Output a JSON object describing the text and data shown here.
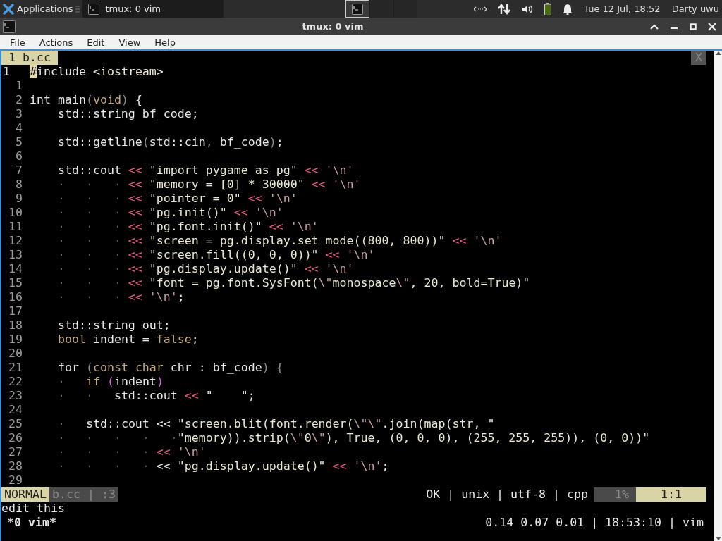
{
  "taskbar": {
    "menu_label": "Applications",
    "tasks": [
      {
        "title": "tmux: 0 vim",
        "selected": true
      }
    ],
    "workspaces": [
      {
        "selected": true
      },
      {
        "selected": false
      },
      {
        "selected": false
      }
    ],
    "clock": "Tue 12 Jul, 18:52",
    "user": "Darty uwu"
  },
  "window": {
    "title": "tmux: 0 vim"
  },
  "menu": [
    "File",
    "Actions",
    "Edit",
    "View",
    "Help"
  ],
  "vim": {
    "tabs": [
      {
        "label": "1 b.cc",
        "selected": true
      }
    ],
    "close_label": "X",
    "lines": [
      {
        "number": "1",
        "current": true,
        "tokens": [
          {
            "kind": "cursor",
            "text": "#"
          },
          {
            "kind": "plain",
            "text": "include "
          },
          {
            "kind": "str",
            "text": "<iostream>"
          }
        ]
      },
      {
        "number": "1",
        "current": false
      },
      {
        "number": "2",
        "current": false,
        "tokens": [
          {
            "kind": "plain",
            "text": "int main"
          },
          {
            "kind": "punct",
            "text": "("
          },
          {
            "kind": "type",
            "text": "void"
          },
          {
            "kind": "punct",
            "text": ")"
          },
          {
            "kind": "plain",
            "text": " {"
          }
        ]
      },
      {
        "number": "3",
        "current": false,
        "tokens": [
          {
            "kind": "plain",
            "text": "    std::string bf_code;"
          }
        ]
      },
      {
        "number": "4",
        "current": false
      },
      {
        "number": "5",
        "current": false,
        "tokens": [
          {
            "kind": "plain",
            "text": "    std::getline"
          },
          {
            "kind": "punct",
            "text": "("
          },
          {
            "kind": "plain",
            "text": "std::cin"
          },
          {
            "kind": "punct",
            "text": ", "
          },
          {
            "kind": "plain",
            "text": "bf_code"
          },
          {
            "kind": "punct",
            "text": ")"
          },
          {
            "kind": "plain",
            "text": ";"
          }
        ]
      },
      {
        "number": "6",
        "current": false
      },
      {
        "number": "7",
        "current": false,
        "tokens": [
          {
            "kind": "plain",
            "text": "    std::cout"
          },
          {
            "kind": "op",
            "text": " << "
          },
          {
            "kind": "str",
            "text": "\"import pygame as pg\""
          },
          {
            "kind": "op",
            "text": " << "
          },
          {
            "kind": "esc",
            "text": "'\\n'"
          }
        ]
      },
      {
        "number": "8",
        "current": false,
        "tokens": [
          {
            "kind": "list",
            "text": "    ·   ·   ·"
          },
          {
            "kind": "op",
            "text": " << "
          },
          {
            "kind": "str",
            "text": "\"memory = [0] * 30000\""
          },
          {
            "kind": "op",
            "text": " << "
          },
          {
            "kind": "esc",
            "text": "'\\n'"
          }
        ]
      },
      {
        "number": "9",
        "current": false,
        "tokens": [
          {
            "kind": "list",
            "text": "    ·   ·   ·"
          },
          {
            "kind": "op",
            "text": " << "
          },
          {
            "kind": "str",
            "text": "\"pointer = 0\""
          },
          {
            "kind": "op",
            "text": " << "
          },
          {
            "kind": "esc",
            "text": "'\\n'"
          }
        ]
      },
      {
        "number": "10",
        "current": false,
        "tokens": [
          {
            "kind": "list",
            "text": "    ·   ·   ·"
          },
          {
            "kind": "op",
            "text": " << "
          },
          {
            "kind": "str",
            "text": "\"pg.init()\""
          },
          {
            "kind": "op",
            "text": " << "
          },
          {
            "kind": "esc",
            "text": "'\\n'"
          }
        ]
      },
      {
        "number": "11",
        "current": false,
        "tokens": [
          {
            "kind": "list",
            "text": "    ·   ·   ·"
          },
          {
            "kind": "op",
            "text": " << "
          },
          {
            "kind": "str",
            "text": "\"pg.font.init()\""
          },
          {
            "kind": "op",
            "text": " << "
          },
          {
            "kind": "esc",
            "text": "'\\n'"
          }
        ]
      },
      {
        "number": "12",
        "current": false,
        "tokens": [
          {
            "kind": "list",
            "text": "    ·   ·   ·"
          },
          {
            "kind": "op",
            "text": " << "
          },
          {
            "kind": "str",
            "text": "\"screen = pg.display.set_mode((800, 800))\""
          },
          {
            "kind": "op",
            "text": " << "
          },
          {
            "kind": "esc",
            "text": "'\\n'"
          }
        ]
      },
      {
        "number": "13",
        "current": false,
        "tokens": [
          {
            "kind": "list",
            "text": "    ·   ·   ·"
          },
          {
            "kind": "op",
            "text": " << "
          },
          {
            "kind": "str",
            "text": "\"screen.fill((0, 0, 0))\""
          },
          {
            "kind": "op",
            "text": " << "
          },
          {
            "kind": "esc",
            "text": "'\\n'"
          }
        ]
      },
      {
        "number": "14",
        "current": false,
        "tokens": [
          {
            "kind": "list",
            "text": "    ·   ·   ·"
          },
          {
            "kind": "op",
            "text": " << "
          },
          {
            "kind": "str",
            "text": "\"pg.display.update()\""
          },
          {
            "kind": "op",
            "text": " << "
          },
          {
            "kind": "esc",
            "text": "'\\n'"
          }
        ]
      },
      {
        "number": "15",
        "current": false,
        "tokens": [
          {
            "kind": "list",
            "text": "    ·   ·   ·"
          },
          {
            "kind": "op",
            "text": " << "
          },
          {
            "kind": "str",
            "text": "\"font = pg.font.SysFont("
          },
          {
            "kind": "esc",
            "text": "\\\""
          },
          {
            "kind": "str",
            "text": "monospace"
          },
          {
            "kind": "esc",
            "text": "\\\""
          },
          {
            "kind": "str",
            "text": ", 20, bold=True)\""
          }
        ]
      },
      {
        "number": "16",
        "current": false,
        "tokens": [
          {
            "kind": "list",
            "text": "    ·   ·   ·"
          },
          {
            "kind": "op",
            "text": " << "
          },
          {
            "kind": "esc",
            "text": "'\\n'"
          },
          {
            "kind": "plain",
            "text": ";"
          }
        ]
      },
      {
        "number": "17",
        "current": false
      },
      {
        "number": "18",
        "current": false,
        "tokens": [
          {
            "kind": "plain",
            "text": "    std::string out;"
          }
        ]
      },
      {
        "number": "19",
        "current": false,
        "tokens": [
          {
            "kind": "type",
            "text": "    bool"
          },
          {
            "kind": "plain",
            "text": " indent = "
          },
          {
            "kind": "type",
            "text": "false"
          },
          {
            "kind": "plain",
            "text": ";"
          }
        ]
      },
      {
        "number": "20",
        "current": false
      },
      {
        "number": "21",
        "current": false,
        "tokens": [
          {
            "kind": "plain",
            "text": "    for "
          },
          {
            "kind": "punct",
            "text": "("
          },
          {
            "kind": "type",
            "text": "const char"
          },
          {
            "kind": "plain",
            "text": " chr : bf_code"
          },
          {
            "kind": "punct",
            "text": ") {"
          }
        ]
      },
      {
        "number": "22",
        "current": false,
        "tokens": [
          {
            "kind": "list",
            "text": "    ·   "
          },
          {
            "kind": "type",
            "text": "if "
          },
          {
            "kind": "bracket",
            "text": "("
          },
          {
            "kind": "plain",
            "text": "indent"
          },
          {
            "kind": "bracket",
            "text": ")"
          }
        ]
      },
      {
        "number": "23",
        "current": false,
        "tokens": [
          {
            "kind": "list",
            "text": "    ·   ·   "
          },
          {
            "kind": "plain",
            "text": "std::cout"
          },
          {
            "kind": "op",
            "text": " << "
          },
          {
            "kind": "str",
            "text": "\"    \""
          },
          {
            "kind": "plain",
            "text": ";"
          }
        ]
      },
      {
        "number": "24",
        "current": false
      },
      {
        "number": "25",
        "current": false,
        "tokens": [
          {
            "kind": "list",
            "text": "    ·   "
          },
          {
            "kind": "plain",
            "text": "std::cout << "
          },
          {
            "kind": "str",
            "text": "\"screen.blit(font.render("
          },
          {
            "kind": "esc",
            "text": "\\\"\\\""
          },
          {
            "kind": "str",
            "text": ".join(map(str, \""
          }
        ]
      },
      {
        "number": "26",
        "current": false,
        "tokens": [
          {
            "kind": "list",
            "text": "    ·   ·   ·   ·   ·"
          },
          {
            "kind": "str",
            "text": "\"memory)).strip("
          },
          {
            "kind": "esc",
            "text": "\\\""
          },
          {
            "kind": "str",
            "text": "0"
          },
          {
            "kind": "esc",
            "text": "\\\""
          },
          {
            "kind": "str",
            "text": "), True, (0, 0, 0), (255, 255, 255)), (0, 0))\""
          }
        ]
      },
      {
        "number": "27",
        "current": false,
        "tokens": [
          {
            "kind": "list",
            "text": "    ·   ·   ·   ·"
          },
          {
            "kind": "op",
            "text": " << "
          },
          {
            "kind": "esc",
            "text": "'\\n'"
          }
        ]
      },
      {
        "number": "28",
        "current": false,
        "tokens": [
          {
            "kind": "list",
            "text": "    ·   ·   ·   ·"
          },
          {
            "kind": "plain",
            "text": " << "
          },
          {
            "kind": "str",
            "text": "\"pg.display.update()\""
          },
          {
            "kind": "op",
            "text": " << "
          },
          {
            "kind": "esc",
            "text": "'\\n'"
          },
          {
            "kind": "plain",
            "text": ";"
          }
        ]
      },
      {
        "number": "29",
        "current": false
      }
    ],
    "statusline": {
      "mode": "NORMAL",
      "file": "b.cc | :3",
      "info": "OK | unix | utf-8 | cpp",
      "percent": "1%",
      "position": "1:1"
    },
    "message": "edit this"
  },
  "tmux": {
    "window": "*0 vim*",
    "status": "0.14 0.07 0.01 | 18:53:10 | vim"
  }
}
